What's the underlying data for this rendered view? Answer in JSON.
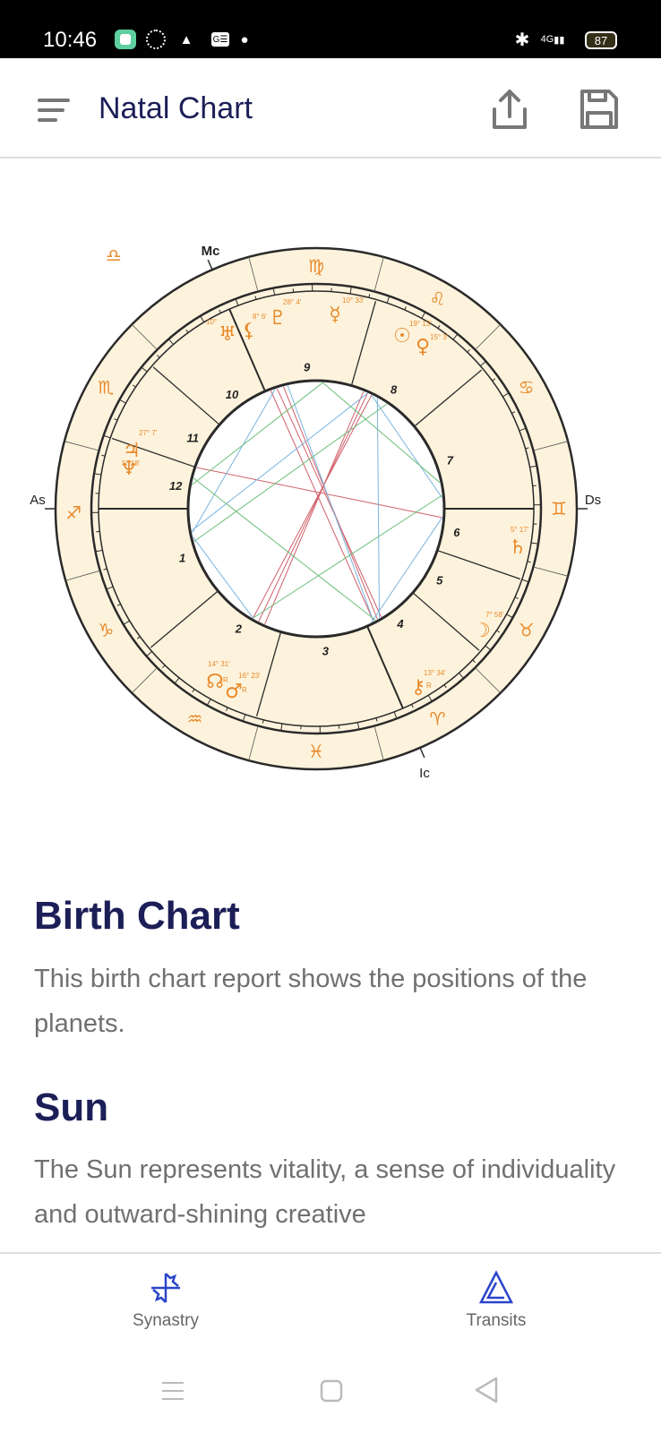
{
  "status_bar": {
    "time": "10:46",
    "network": "4G",
    "battery": "87",
    "icons": [
      "app-icon",
      "globe-icon",
      "drive-icon",
      "ge-icon",
      "dot-icon",
      "bluetooth-icon",
      "signal-icon",
      "battery-icon"
    ]
  },
  "app_bar": {
    "title": "Natal Chart",
    "icons": [
      "menu-icon",
      "share-icon",
      "save-icon"
    ]
  },
  "chart": {
    "angles": {
      "asc": "As",
      "desc": "Ds",
      "mc": "Mc",
      "ic": "Ic"
    },
    "signs": [
      "♐︎",
      "♑︎",
      "♒︎",
      "♓︎",
      "♈︎",
      "♉︎",
      "♊︎",
      "♋︎",
      "♌︎",
      "♍︎",
      "♎︎",
      "♏︎"
    ],
    "houses": [
      "1",
      "2",
      "3",
      "4",
      "5",
      "6",
      "7",
      "8",
      "9",
      "10",
      "11",
      "12"
    ],
    "planets": [
      {
        "name": "Uranus",
        "glyph": "♅",
        "degree": "10°",
        "retro": ""
      },
      {
        "name": "Lilith",
        "glyph": "⚸",
        "degree": "8° 6'",
        "retro": ""
      },
      {
        "name": "Pluto",
        "glyph": "♇",
        "degree": "28° 4'",
        "retro": ""
      },
      {
        "name": "Mercury",
        "glyph": "☿",
        "degree": "10° 33'",
        "retro": ""
      },
      {
        "name": "Sun",
        "glyph": "☉",
        "degree": "19° 13'",
        "retro": ""
      },
      {
        "name": "Venus",
        "glyph": "♀",
        "degree": "15° 3'",
        "retro": ""
      },
      {
        "name": "Saturn",
        "glyph": "♄",
        "degree": "5° 17'",
        "retro": ""
      },
      {
        "name": "Moon",
        "glyph": "☽",
        "degree": "7° 58'",
        "retro": ""
      },
      {
        "name": "Chiron",
        "glyph": "⚷",
        "degree": "13° 34'",
        "retro": "R"
      },
      {
        "name": "Node",
        "glyph": "☊",
        "degree": "14° 31'",
        "retro": "R"
      },
      {
        "name": "Mars",
        "glyph": "♂",
        "degree": "16° 23'",
        "retro": "R"
      },
      {
        "name": "Jupiter",
        "glyph": "♃",
        "degree": "27° 7'",
        "retro": ""
      },
      {
        "name": "Neptune",
        "glyph": "♆",
        "degree": "5° 18'",
        "retro": ""
      }
    ],
    "colors": {
      "background": "#fdf3dc",
      "glyph": "#e8892a",
      "line": "#2a2a2a",
      "aspect_red": "#d0606a",
      "aspect_blue": "#7ab4e0",
      "aspect_green": "#6cbf7c"
    }
  },
  "sections": [
    {
      "heading": "Birth Chart",
      "text": "This birth chart report shows the positions of the planets."
    },
    {
      "heading": "Sun",
      "text": "The Sun represents vitality, a sense of individuality and outward-shining creative"
    }
  ],
  "bottom_nav": [
    {
      "label": "Synastry",
      "icon": "synastry-icon"
    },
    {
      "label": "Transits",
      "icon": "transits-icon"
    }
  ],
  "system_nav": [
    "recents-icon",
    "home-icon",
    "back-icon"
  ],
  "accent": "#2a44c9"
}
